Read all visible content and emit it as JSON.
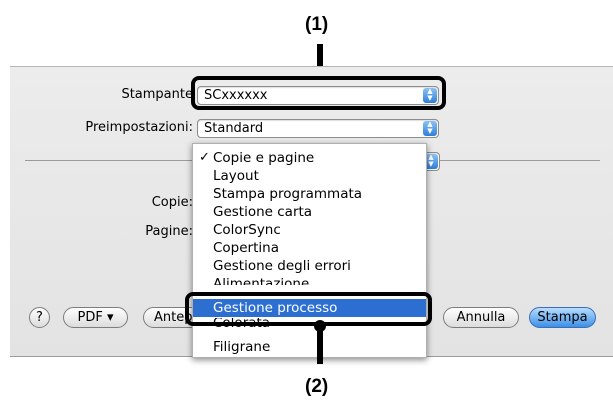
{
  "callouts": {
    "one": "(1)",
    "two": "(2)"
  },
  "printer": {
    "label": "Stampante",
    "value": "SCxxxxxx"
  },
  "presets": {
    "label": "Preimpostazioni:",
    "value": "Standard"
  },
  "fields": {
    "copies_label": "Copie:",
    "pages_label": "Pagine:"
  },
  "menu": {
    "items": [
      {
        "label": "Copie e pagine",
        "checked": true
      },
      {
        "label": "Layout"
      },
      {
        "label": "Stampa programmata"
      },
      {
        "label": "Gestione carta"
      },
      {
        "label": "ColorSync"
      },
      {
        "label": "Copertina"
      },
      {
        "label": "Gestione degli errori"
      },
      {
        "label": "Alimentazione"
      },
      {
        "label": "Gestione processo",
        "selected": true
      },
      {
        "label": "Colorata"
      },
      {
        "label": "Filigrane"
      }
    ],
    "checkmark": "✓"
  },
  "buttons": {
    "help": "?",
    "pdf": "PDF ▾",
    "preview": "Anteprima",
    "cancel": "Annulla",
    "print": "Stampa"
  },
  "colors": {
    "selection": "#2c6fd1",
    "default_button": "#3d8fe6"
  }
}
